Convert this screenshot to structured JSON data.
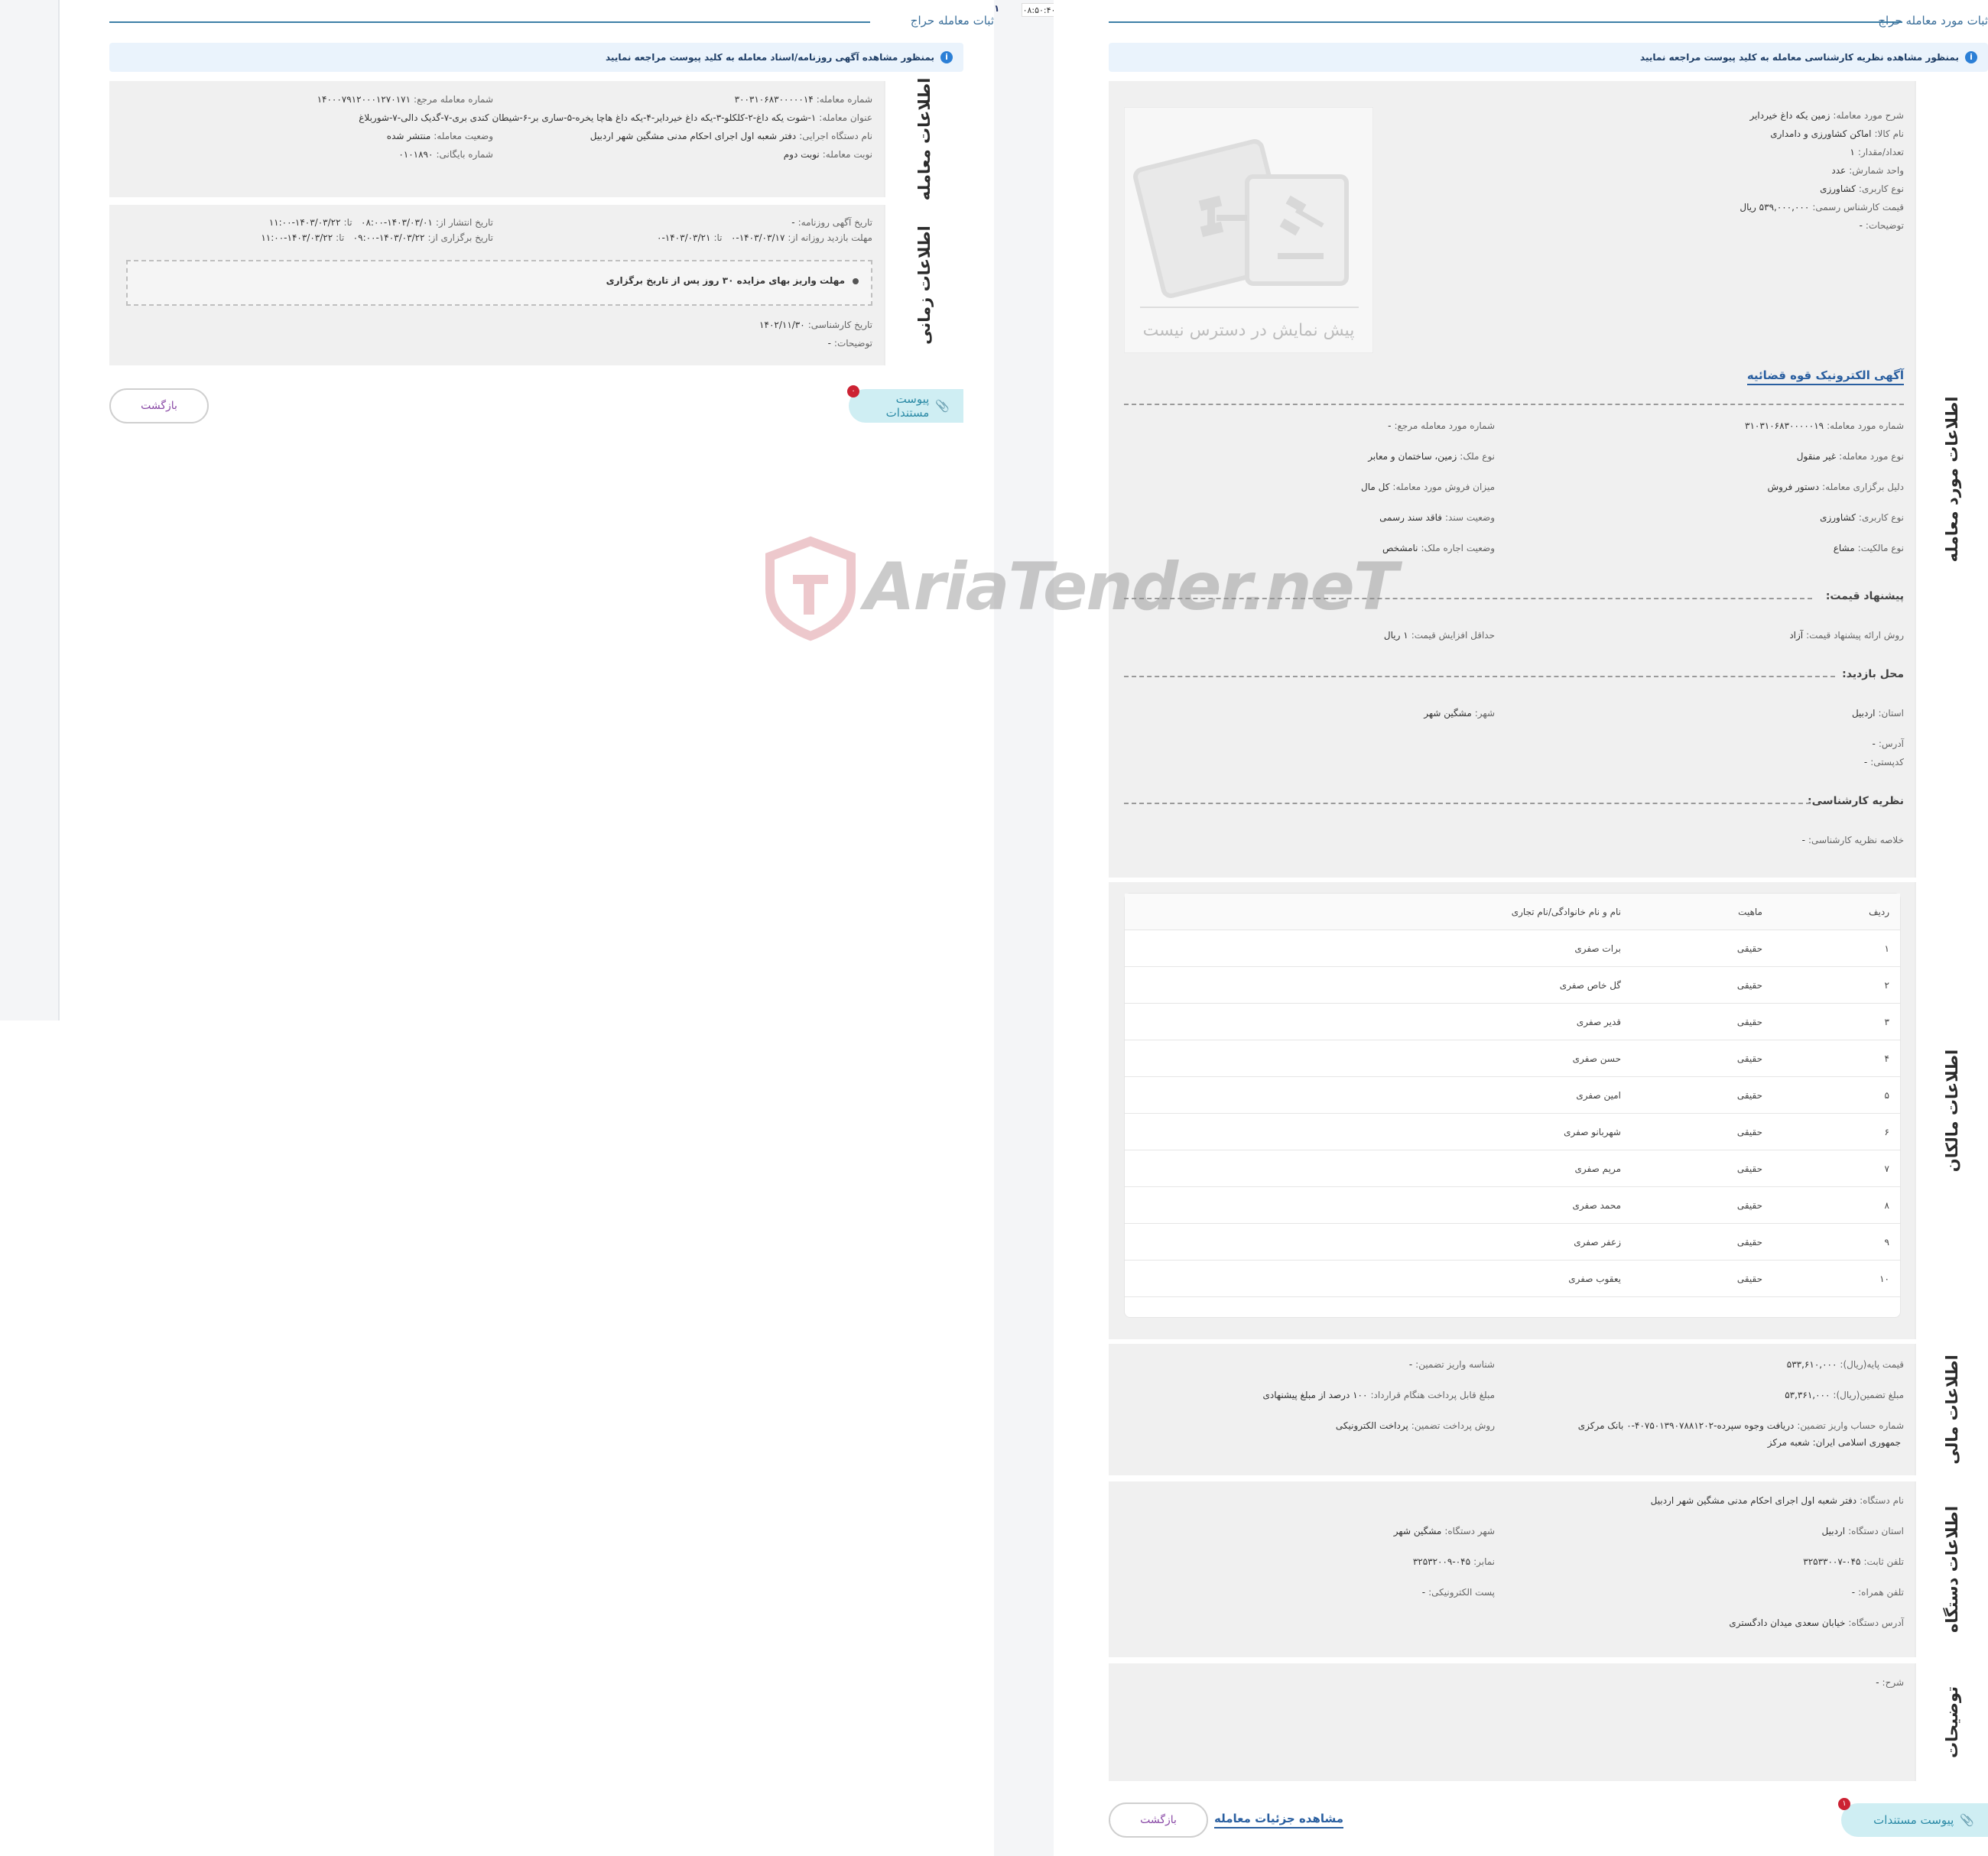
{
  "left": {
    "title": "ثبات معامله حراج",
    "info_bar": "بمنظور مشاهده آگهی روزنامه/اسناد معامله به کلید پیوست مراجعه نمایید",
    "deal_tab": "اطلاعات معامله",
    "time_tab": "اطلاعات زمانی",
    "deal": {
      "deal_number_label": "شماره معامله:",
      "deal_number": "۳۰۰۳۱۰۶۸۳۰۰۰۰۰۱۴",
      "ref_number_label": "شماره معامله مرجع:",
      "ref_number": "۱۴۰۰۰۷۹۱۲۰۰۰۱۲۷۰۱۷۱",
      "deal_title_label": "عنوان معامله:",
      "deal_title": "۱-شوت یکه داغ-۲-کلکلو-۳-یکه داغ خیردایر-۴-یکه داغ هاچا یخره-۵-ساری بر-۶-شیطان کندی بری-۷-گدیک دالی-۷-شوربلاغ",
      "agency_label": "نام دستگاه اجرایی:",
      "agency": "دفتر شعبه اول اجرای احکام مدنی مشگین شهر اردبیل",
      "status_label": "وضعیت معامله:",
      "status": "منتشر شده",
      "round_label": "نوبت معامله:",
      "round": "نوبت دوم",
      "archive_label": "شماره بایگانی:",
      "archive": "۰۱۰۱۸۹۰"
    },
    "time": {
      "newspaper_label": "تاریخ آگهی روزنامه:",
      "newspaper": "-",
      "publish_label": "تاریخ انتشار از:",
      "publish_from": "۱۴۰۳/۰۳/۰۱-۰۸:۰۰",
      "to_label": "تا:",
      "publish_to": "۱۴۰۳/۰۳/۲۲-۱۱:۰۰",
      "visit_label": "مهلت بازدید روزانه از:",
      "visit_from": "۱۴۰۳/۰۳/۱۷-۰",
      "visit_to": "۱۴۰۳/۰۳/۲۱-۰",
      "hold_label": "تاریخ برگزاری از:",
      "hold_from": "۱۴۰۳/۰۳/۲۲-۰۹:۰۰",
      "hold_to": "۱۴۰۳/۰۳/۲۲-۱۱:۰۰",
      "note": "مهلت واریز بهای مزایده ۳۰ روز پس از تاریخ برگزاری",
      "expert_date_label": "تاریخ کارشناسی:",
      "expert_date": "۱۴۰۲/۱۱/۳۰",
      "desc_label": "توضیحات:",
      "desc": "-"
    },
    "attach_label": "پیوست مستندات",
    "attach_badge": "۰",
    "back_label": "بازگشت"
  },
  "divider": {
    "clock": "۰۸:۵۰:۴۰",
    "page_marker": "۱"
  },
  "right": {
    "title": "ثبات مورد معامله حراج",
    "info_bar": "بمنظور مشاهده نظریه کارشناسی معامله به کلید پیوست مراجعه نمایید",
    "item_tab": "اطلاعات مورد معامله",
    "item": {
      "desc_label": "شرح مورد معامله:",
      "desc": "زمین یکه داغ خیردایر",
      "goods_label": "نام کالا:",
      "goods": "اماکن کشاورزی و دامداری",
      "qty_label": "تعداد/مقدار:",
      "qty": "۱",
      "unit_label": "واحد شمارش:",
      "unit": "عدد",
      "use_label": "نوع کاربری:",
      "use": "کشاورزی",
      "price_label": "قیمت کارشناس رسمی:",
      "price": "۵۳۹,۰۰۰,۰۰۰ ریال",
      "notes_label": "توضیحات:",
      "notes": "-",
      "preview_unavailable": "پیش نمایش در دسترس نیست",
      "ad_link": "آگهی الکترونیک قوه قضائیه",
      "item_number_label": "شماره مورد معامله:",
      "item_number": "۳۱۰۳۱۰۶۸۳۰۰۰۰۰۱۹",
      "item_ref_label": "شماره مورد معامله مرجع:",
      "item_ref": "-",
      "item_type_label": "نوع مورد معامله:",
      "item_type": "غیر منقول",
      "property_type_label": "نوع ملک:",
      "property_type": "زمین، ساختمان و معابر",
      "reason_label": "دلیل برگزاری معامله:",
      "reason": "دستور فروش",
      "sale_amount_label": "میزان فروش مورد معامله:",
      "sale_amount": "کل مال",
      "use2_label": "نوع کاربری:",
      "use2": "کشاورزی",
      "deed_label": "وضعیت سند:",
      "deed": "فاقد سند رسمی",
      "ownership_label": "نوع مالکیت:",
      "ownership": "مشاع",
      "lease_label": "وضعیت اجاره ملک:",
      "lease": "نامشخص",
      "offer_heading": "پیشنهاد قیمت:",
      "offer_method_label": "روش ارائه پیشنهاد قیمت:",
      "offer_method": "آزاد",
      "min_increase_label": "حداقل افزایش قیمت:",
      "min_increase": "۱ ریال",
      "visit_heading": "محل بازدید:",
      "province_label": "استان:",
      "province": "اردبیل",
      "city_label": "شهر:",
      "city": "مشگین شهر",
      "address_label": "آدرس:",
      "address": "-",
      "postal_label": "کدپستی:",
      "postal": "-",
      "expert_heading": "نظریه کارشناسی:",
      "expert_summary_label": "خلاصه نظریه کارشناسی:",
      "expert_summary": "-"
    },
    "owners_tab": "اطلاعات مالکان",
    "owners": {
      "columns": [
        "ردیف",
        "ماهیت",
        "نام و نام خانوادگی/نام تجاری"
      ],
      "rows": [
        [
          "۱",
          "حقیقی",
          "برات صفری"
        ],
        [
          "۲",
          "حقیقی",
          "گل خاص صفری"
        ],
        [
          "۳",
          "حقیقی",
          "قدیر صفری"
        ],
        [
          "۴",
          "حقیقی",
          "حسن صفری"
        ],
        [
          "۵",
          "حقیقی",
          "امین صفری"
        ],
        [
          "۶",
          "حقیقی",
          "شهربانو صفری"
        ],
        [
          "۷",
          "حقیقی",
          "مریم صفری"
        ],
        [
          "۸",
          "حقیقی",
          "محمد صفری"
        ],
        [
          "۹",
          "حقیقی",
          "زعفر صفری"
        ],
        [
          "۱۰",
          "حقیقی",
          "یعقوب صفری"
        ]
      ]
    },
    "finance_tab": "اطلاعات مالی",
    "finance": {
      "base_price_label": "قیمت پایه(ریال):",
      "base_price": "۵۳۳,۶۱۰,۰۰۰",
      "deposit_id_label": "شناسه واریز تضمین:",
      "deposit_id": "-",
      "guarantee_label": "مبلغ تضمین(ریال):",
      "guarantee": "۵۳,۳۶۱,۰۰۰",
      "contract_pay_label": "مبلغ قابل پرداخت هنگام قرارداد:",
      "contract_pay": "۱۰۰ درصد از مبلغ پیشنهادی",
      "account_label": "شماره حساب واریز تضمین:",
      "account": "دریافت وجوه سپرده-۴۰۷۵۰۱۳۹۰۷۸۸۱۲۰۲-۰ بانک مرکزی",
      "account2": "جمهوری اسلامی ایران: شعبه مرکز",
      "pay_method_label": "روش پرداخت تضمین:",
      "pay_method": "پرداخت الکترونیکی"
    },
    "device_tab": "اطلاعات دستگاه",
    "device": {
      "name_label": "نام دستگاه:",
      "name": "دفتر شعبه اول اجرای احکام مدنی مشگین شهر اردبیل",
      "province_label": "استان دستگاه:",
      "province": "اردبیل",
      "city_label": "شهر دستگاه:",
      "city": "مشگین شهر",
      "phone_label": "تلفن ثابت:",
      "phone": "۰۴۵-۳۲۵۳۳۰۰۷",
      "fax_label": "نمابر:",
      "fax": "۰۴۵-۳۲۵۳۲۰۰۹",
      "mobile_label": "تلفن همراه:",
      "mobile": "-",
      "email_label": "پست الکترونیکی:",
      "email": "-",
      "address_label": "آدرس دستگاه:",
      "address": "خیابان سعدی میدان دادگستری"
    },
    "desc_tab": "توضیحات",
    "desc": {
      "label": "شرح:",
      "value": "-"
    },
    "attach_label": "پیوست مستندات",
    "attach_badge": "۱",
    "details_label": "مشاهده جزئیات معامله",
    "back_label": "بازگشت"
  }
}
